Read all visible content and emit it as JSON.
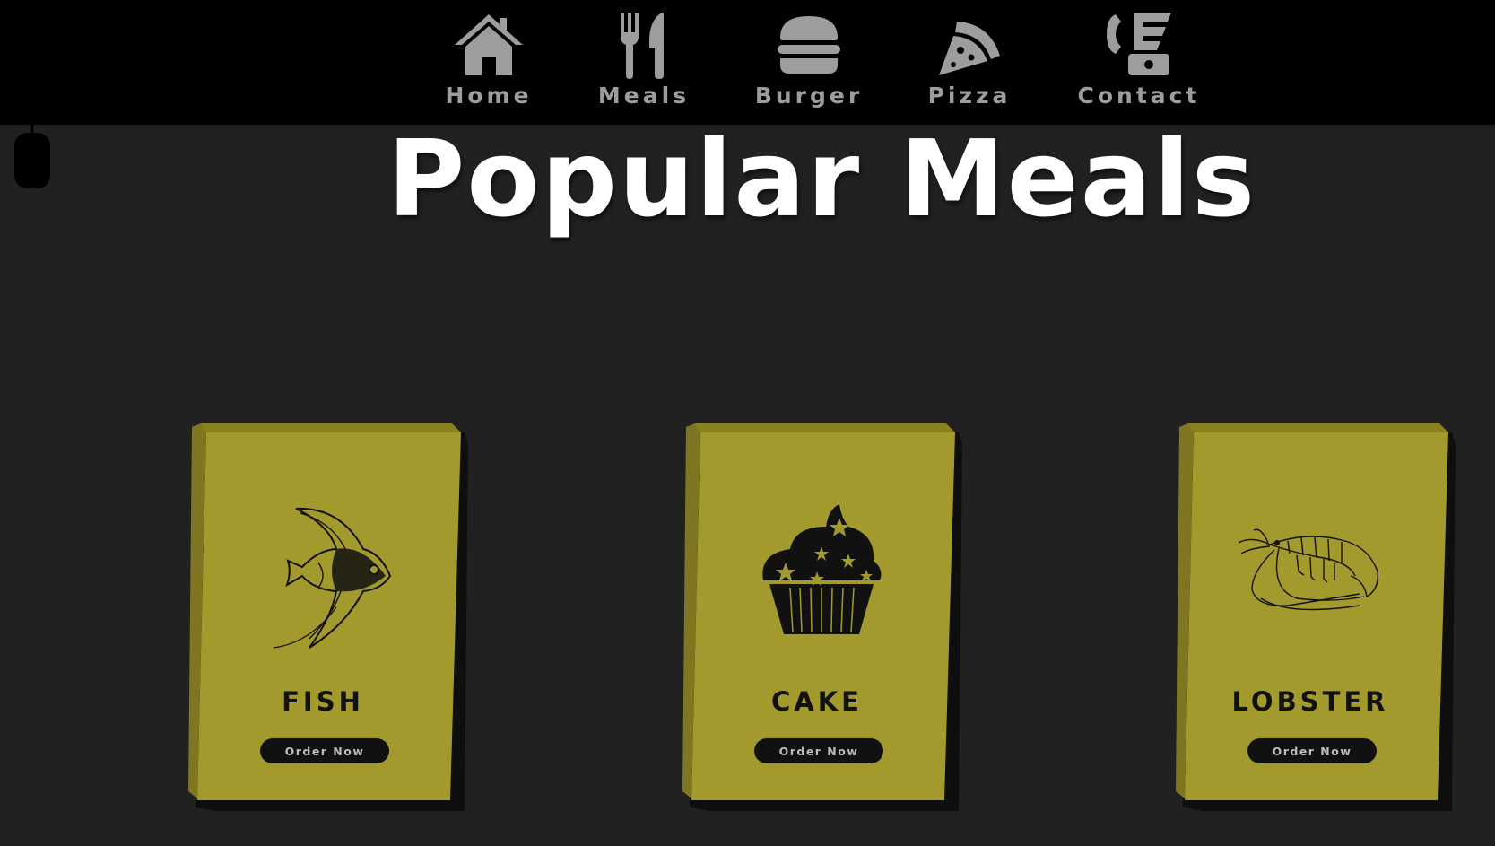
{
  "nav": {
    "items": [
      {
        "label": "Home",
        "icon": "home-icon"
      },
      {
        "label": "Meals",
        "icon": "utensils-icon"
      },
      {
        "label": "Burger",
        "icon": "burger-icon"
      },
      {
        "label": "Pizza",
        "icon": "pizza-icon"
      },
      {
        "label": "Contact",
        "icon": "phone-icon"
      }
    ],
    "icon_color": "#9d9d9d",
    "background": "#000000"
  },
  "main": {
    "title": "Popular Meals",
    "background": "#212121"
  },
  "cards": [
    {
      "name": "FISH",
      "button": "Order Now",
      "image": "fish-illustration"
    },
    {
      "name": "CAKE",
      "button": "Order Now",
      "image": "cupcake-illustration"
    },
    {
      "name": "LOBSTER",
      "button": "Order Now",
      "image": "shrimp-illustration"
    }
  ],
  "card_color": "#a39a2e"
}
